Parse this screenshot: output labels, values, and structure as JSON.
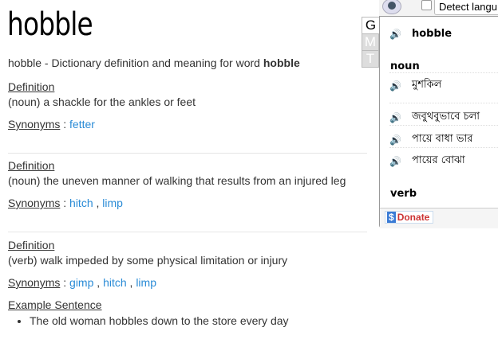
{
  "title": "hobble",
  "subtitle_prefix": "hobble - Dictionary definition and meaning for word ",
  "subtitle_bold": "hobble",
  "definition_label": "Definition",
  "synonyms_label": "Synonyms",
  "separator": " : ",
  "comma": " , ",
  "entries": [
    {
      "text": "(noun) a shackle for the ankles or feet",
      "synonyms": [
        "fetter"
      ]
    },
    {
      "text": "(noun) the uneven manner of walking that results from an injured leg",
      "synonyms": [
        "hitch",
        "limp"
      ]
    },
    {
      "text": "(verb) walk impeded by some physical limitation or injury",
      "synonyms": [
        "gimp",
        "hitch",
        "limp"
      ]
    }
  ],
  "example_label": "Example Sentence",
  "example": "The old woman hobbles down to the store every day",
  "popup": {
    "language_select": "Detect langu",
    "tabs": [
      "G",
      "M",
      "T"
    ],
    "word": "hobble",
    "noun_label": "noun",
    "noun_items": [
      "মুশকিল",
      "জবুথবুভাবে চলা",
      "পায়ে বাধা ভার",
      "পায়ের বোঝা"
    ],
    "verb_label": "verb",
    "donate": "Donate",
    "donate_icon": "$"
  }
}
